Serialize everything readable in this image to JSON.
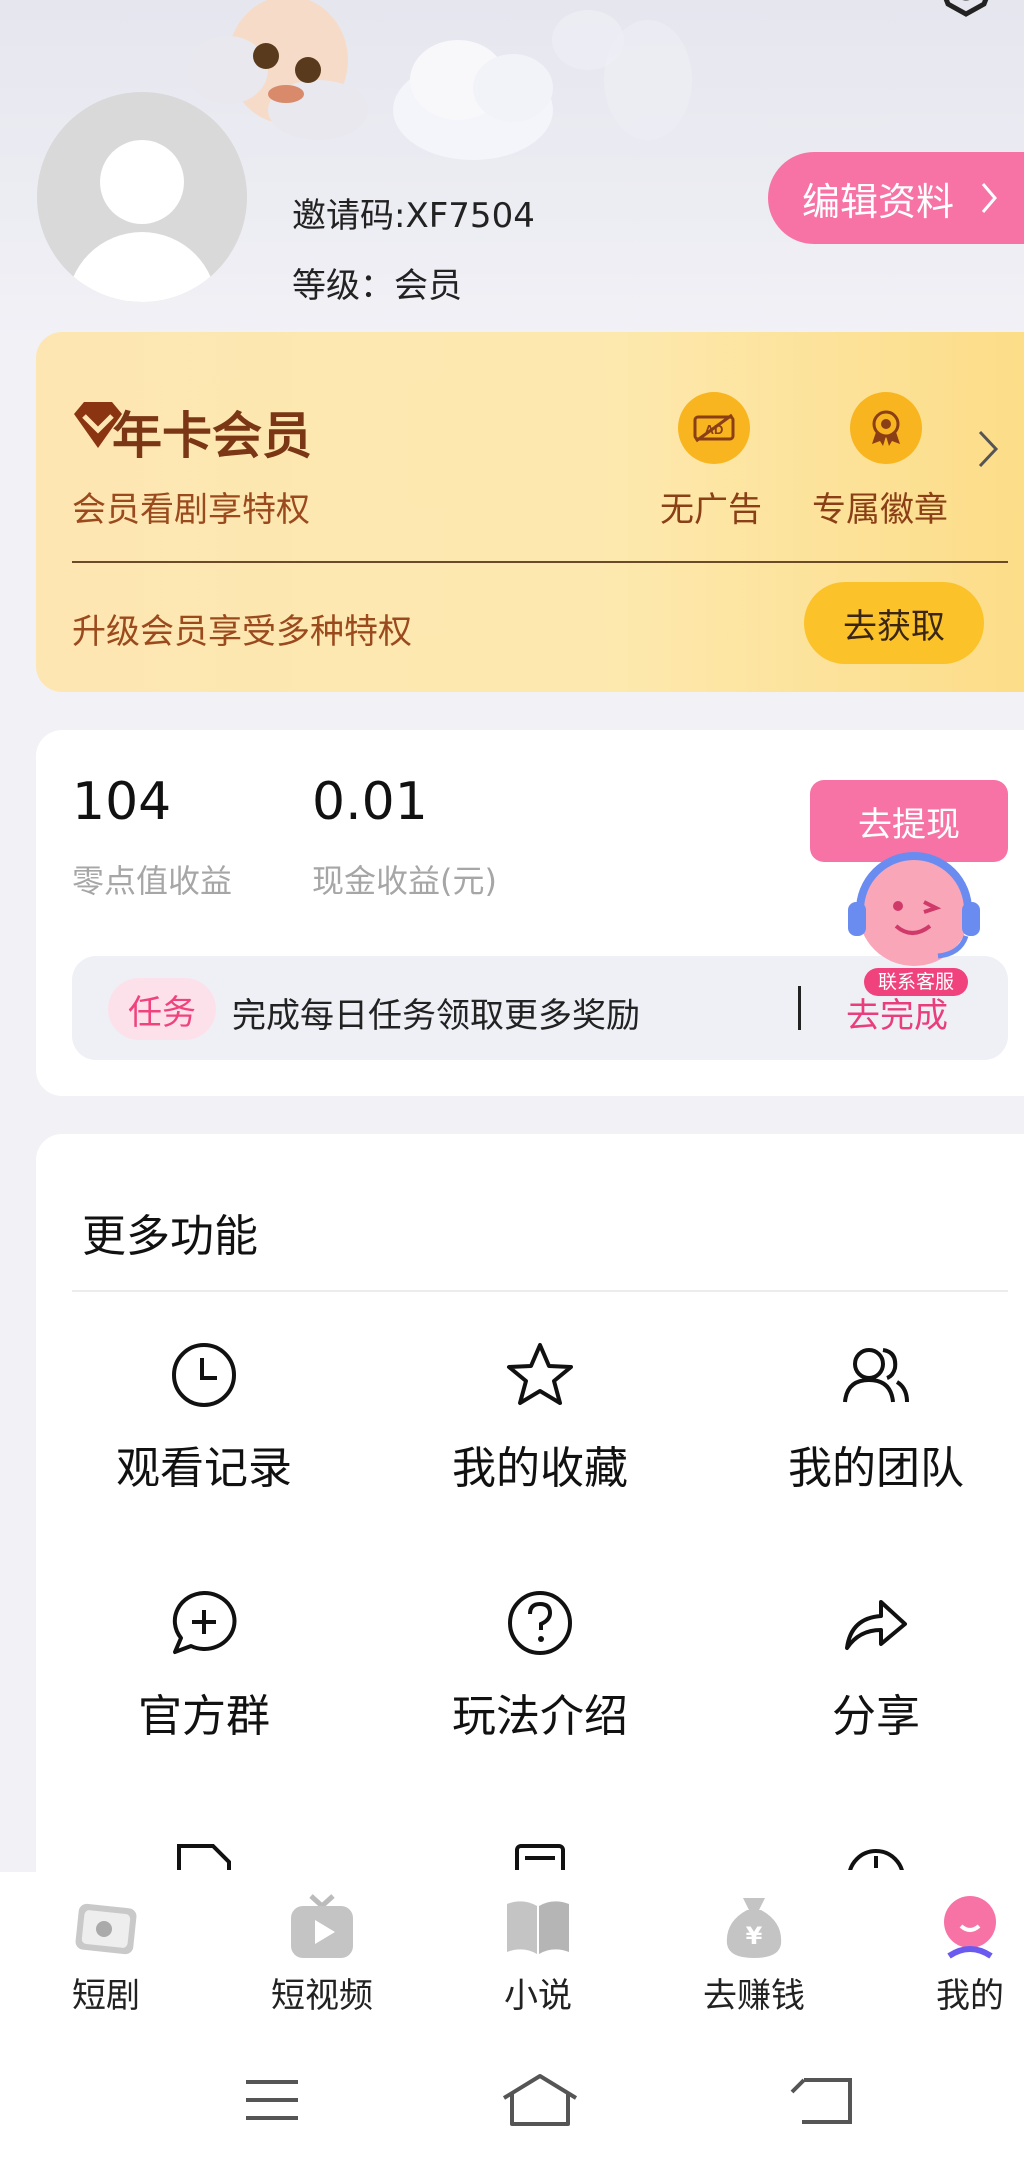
{
  "profile": {
    "nickname_visible": "",
    "invite_code": "邀请码:XF7504",
    "level": "等级：会员",
    "edit_button": "编辑资料"
  },
  "vip": {
    "title": "年卡会员",
    "subtitle": "会员看剧享特权",
    "perks": [
      {
        "label": "无广告",
        "icon": "no-ads-icon"
      },
      {
        "label": "专属徽章",
        "icon": "badge-icon"
      }
    ],
    "promo": "升级会员享受多种特权",
    "get_button": "去获取"
  },
  "earnings": {
    "points_value": "104",
    "points_label": "零点值收益",
    "cash_value": "0.01",
    "cash_label": "现金收益(元)",
    "withdraw_button": "去提现",
    "task_tag": "任务",
    "task_text": "完成每日任务领取更多奖励",
    "task_go": "去完成",
    "customer_service_label": "联系客服"
  },
  "functions": {
    "title": "更多功能",
    "items": [
      {
        "label": "观看记录",
        "icon": "clock-icon"
      },
      {
        "label": "我的收藏",
        "icon": "star-icon"
      },
      {
        "label": "我的团队",
        "icon": "team-icon"
      },
      {
        "label": "官方群",
        "icon": "chat-plus-icon"
      },
      {
        "label": "玩法介绍",
        "icon": "question-icon"
      },
      {
        "label": "分享",
        "icon": "share-icon"
      }
    ]
  },
  "bottom_nav": {
    "items": [
      {
        "label": "短剧",
        "icon": "tv-drama-icon"
      },
      {
        "label": "短视频",
        "icon": "video-icon"
      },
      {
        "label": "小说",
        "icon": "book-icon"
      },
      {
        "label": "去赚钱",
        "icon": "money-bag-icon"
      },
      {
        "label": "我的",
        "icon": "profile-icon"
      }
    ],
    "active_index": 4
  },
  "colors": {
    "accent_pink": "#f773a6",
    "vip_gold": "#fbc22a",
    "vip_text": "#7a3615"
  }
}
